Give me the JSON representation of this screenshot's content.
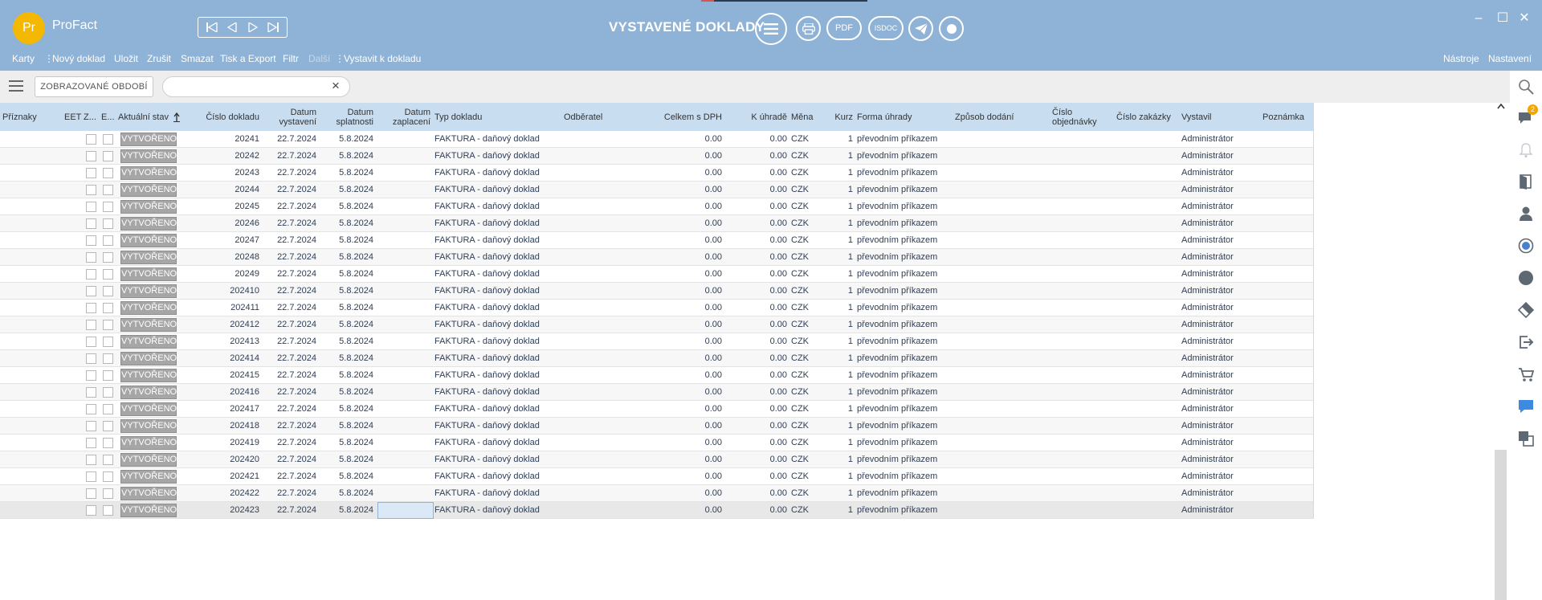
{
  "app": {
    "logo_text": "Pr",
    "name": "ProFact",
    "title": "VYSTAVENÉ DOKLADY",
    "pdf_label": "PDF",
    "isdoc_label": "ISDOC",
    "window_minimize": "–",
    "window_maximize": "☐",
    "window_close": "✕"
  },
  "menu": {
    "karty": "Karty",
    "novy": "Nový doklad",
    "ulozit": "Uložit",
    "zrusit": "Zrušit",
    "smazat": "Smazat",
    "tisk": "Tisk a Export",
    "filtr": "Filtr",
    "dalsi": "Další",
    "vystavit": "Vystavit k dokladu",
    "nastroje": "Nástroje",
    "nastaveni": "Nastavení",
    "separator": "⋮"
  },
  "toolbar": {
    "period_label": "ZOBRAZOVANÉ OBDOBÍ",
    "search_value": "",
    "search_clear": "×"
  },
  "notifications": {
    "messages_count": "2"
  },
  "columns": {
    "priznaky": "Příznaky",
    "eet": "EET",
    "z": "Z...",
    "e": "E...",
    "stav": "Aktuální stav",
    "cislo": "Číslo dokladu",
    "vystaveni": "Datum vystavení",
    "splatnosti": "Datum splatnosti",
    "zaplaceni": "Datum zaplacení",
    "typ": "Typ dokladu",
    "odberatel": "Odběratel",
    "celkem": "Celkem s DPH",
    "k_uhrade": "K úhradě",
    "mena": "Měna",
    "kurz": "Kurz",
    "forma": "Forma úhrady",
    "zpusob": "Způsob dodání",
    "objednavka": "Číslo objednávky",
    "zakazka": "Číslo zakázky",
    "vystavil": "Vystavil",
    "poznamka": "Poznámka"
  },
  "rows": [
    {
      "stav": "VYTVOŘENO",
      "cislo": "20241",
      "vystaveni": "22.7.2024",
      "splatnosti": "5.8.2024",
      "typ": "FAKTURA - daňový doklad",
      "celkem": "0.00",
      "k_uhrade": "0.00",
      "mena": "CZK",
      "kurz": "1",
      "forma": "převodním příkazem",
      "vystavil": "Administrátor"
    },
    {
      "stav": "VYTVOŘENO",
      "cislo": "20242",
      "vystaveni": "22.7.2024",
      "splatnosti": "5.8.2024",
      "typ": "FAKTURA - daňový doklad",
      "celkem": "0.00",
      "k_uhrade": "0.00",
      "mena": "CZK",
      "kurz": "1",
      "forma": "převodním příkazem",
      "vystavil": "Administrátor"
    },
    {
      "stav": "VYTVOŘENO",
      "cislo": "20243",
      "vystaveni": "22.7.2024",
      "splatnosti": "5.8.2024",
      "typ": "FAKTURA - daňový doklad",
      "celkem": "0.00",
      "k_uhrade": "0.00",
      "mena": "CZK",
      "kurz": "1",
      "forma": "převodním příkazem",
      "vystavil": "Administrátor"
    },
    {
      "stav": "VYTVOŘENO",
      "cislo": "20244",
      "vystaveni": "22.7.2024",
      "splatnosti": "5.8.2024",
      "typ": "FAKTURA - daňový doklad",
      "celkem": "0.00",
      "k_uhrade": "0.00",
      "mena": "CZK",
      "kurz": "1",
      "forma": "převodním příkazem",
      "vystavil": "Administrátor"
    },
    {
      "stav": "VYTVOŘENO",
      "cislo": "20245",
      "vystaveni": "22.7.2024",
      "splatnosti": "5.8.2024",
      "typ": "FAKTURA - daňový doklad",
      "celkem": "0.00",
      "k_uhrade": "0.00",
      "mena": "CZK",
      "kurz": "1",
      "forma": "převodním příkazem",
      "vystavil": "Administrátor"
    },
    {
      "stav": "VYTVOŘENO",
      "cislo": "20246",
      "vystaveni": "22.7.2024",
      "splatnosti": "5.8.2024",
      "typ": "FAKTURA - daňový doklad",
      "celkem": "0.00",
      "k_uhrade": "0.00",
      "mena": "CZK",
      "kurz": "1",
      "forma": "převodním příkazem",
      "vystavil": "Administrátor"
    },
    {
      "stav": "VYTVOŘENO",
      "cislo": "20247",
      "vystaveni": "22.7.2024",
      "splatnosti": "5.8.2024",
      "typ": "FAKTURA - daňový doklad",
      "celkem": "0.00",
      "k_uhrade": "0.00",
      "mena": "CZK",
      "kurz": "1",
      "forma": "převodním příkazem",
      "vystavil": "Administrátor"
    },
    {
      "stav": "VYTVOŘENO",
      "cislo": "20248",
      "vystaveni": "22.7.2024",
      "splatnosti": "5.8.2024",
      "typ": "FAKTURA - daňový doklad",
      "celkem": "0.00",
      "k_uhrade": "0.00",
      "mena": "CZK",
      "kurz": "1",
      "forma": "převodním příkazem",
      "vystavil": "Administrátor"
    },
    {
      "stav": "VYTVOŘENO",
      "cislo": "20249",
      "vystaveni": "22.7.2024",
      "splatnosti": "5.8.2024",
      "typ": "FAKTURA - daňový doklad",
      "celkem": "0.00",
      "k_uhrade": "0.00",
      "mena": "CZK",
      "kurz": "1",
      "forma": "převodním příkazem",
      "vystavil": "Administrátor"
    },
    {
      "stav": "VYTVOŘENO",
      "cislo": "202410",
      "vystaveni": "22.7.2024",
      "splatnosti": "5.8.2024",
      "typ": "FAKTURA - daňový doklad",
      "celkem": "0.00",
      "k_uhrade": "0.00",
      "mena": "CZK",
      "kurz": "1",
      "forma": "převodním příkazem",
      "vystavil": "Administrátor"
    },
    {
      "stav": "VYTVOŘENO",
      "cislo": "202411",
      "vystaveni": "22.7.2024",
      "splatnosti": "5.8.2024",
      "typ": "FAKTURA - daňový doklad",
      "celkem": "0.00",
      "k_uhrade": "0.00",
      "mena": "CZK",
      "kurz": "1",
      "forma": "převodním příkazem",
      "vystavil": "Administrátor"
    },
    {
      "stav": "VYTVOŘENO",
      "cislo": "202412",
      "vystaveni": "22.7.2024",
      "splatnosti": "5.8.2024",
      "typ": "FAKTURA - daňový doklad",
      "celkem": "0.00",
      "k_uhrade": "0.00",
      "mena": "CZK",
      "kurz": "1",
      "forma": "převodním příkazem",
      "vystavil": "Administrátor"
    },
    {
      "stav": "VYTVOŘENO",
      "cislo": "202413",
      "vystaveni": "22.7.2024",
      "splatnosti": "5.8.2024",
      "typ": "FAKTURA - daňový doklad",
      "celkem": "0.00",
      "k_uhrade": "0.00",
      "mena": "CZK",
      "kurz": "1",
      "forma": "převodním příkazem",
      "vystavil": "Administrátor"
    },
    {
      "stav": "VYTVOŘENO",
      "cislo": "202414",
      "vystaveni": "22.7.2024",
      "splatnosti": "5.8.2024",
      "typ": "FAKTURA - daňový doklad",
      "celkem": "0.00",
      "k_uhrade": "0.00",
      "mena": "CZK",
      "kurz": "1",
      "forma": "převodním příkazem",
      "vystavil": "Administrátor"
    },
    {
      "stav": "VYTVOŘENO",
      "cislo": "202415",
      "vystaveni": "22.7.2024",
      "splatnosti": "5.8.2024",
      "typ": "FAKTURA - daňový doklad",
      "celkem": "0.00",
      "k_uhrade": "0.00",
      "mena": "CZK",
      "kurz": "1",
      "forma": "převodním příkazem",
      "vystavil": "Administrátor"
    },
    {
      "stav": "VYTVOŘENO",
      "cislo": "202416",
      "vystaveni": "22.7.2024",
      "splatnosti": "5.8.2024",
      "typ": "FAKTURA - daňový doklad",
      "celkem": "0.00",
      "k_uhrade": "0.00",
      "mena": "CZK",
      "kurz": "1",
      "forma": "převodním příkazem",
      "vystavil": "Administrátor"
    },
    {
      "stav": "VYTVOŘENO",
      "cislo": "202417",
      "vystaveni": "22.7.2024",
      "splatnosti": "5.8.2024",
      "typ": "FAKTURA - daňový doklad",
      "celkem": "0.00",
      "k_uhrade": "0.00",
      "mena": "CZK",
      "kurz": "1",
      "forma": "převodním příkazem",
      "vystavil": "Administrátor"
    },
    {
      "stav": "VYTVOŘENO",
      "cislo": "202418",
      "vystaveni": "22.7.2024",
      "splatnosti": "5.8.2024",
      "typ": "FAKTURA - daňový doklad",
      "celkem": "0.00",
      "k_uhrade": "0.00",
      "mena": "CZK",
      "kurz": "1",
      "forma": "převodním příkazem",
      "vystavil": "Administrátor"
    },
    {
      "stav": "VYTVOŘENO",
      "cislo": "202419",
      "vystaveni": "22.7.2024",
      "splatnosti": "5.8.2024",
      "typ": "FAKTURA - daňový doklad",
      "celkem": "0.00",
      "k_uhrade": "0.00",
      "mena": "CZK",
      "kurz": "1",
      "forma": "převodním příkazem",
      "vystavil": "Administrátor"
    },
    {
      "stav": "VYTVOŘENO",
      "cislo": "202420",
      "vystaveni": "22.7.2024",
      "splatnosti": "5.8.2024",
      "typ": "FAKTURA - daňový doklad",
      "celkem": "0.00",
      "k_uhrade": "0.00",
      "mena": "CZK",
      "kurz": "1",
      "forma": "převodním příkazem",
      "vystavil": "Administrátor"
    },
    {
      "stav": "VYTVOŘENO",
      "cislo": "202421",
      "vystaveni": "22.7.2024",
      "splatnosti": "5.8.2024",
      "typ": "FAKTURA - daňový doklad",
      "celkem": "0.00",
      "k_uhrade": "0.00",
      "mena": "CZK",
      "kurz": "1",
      "forma": "převodním příkazem",
      "vystavil": "Administrátor"
    },
    {
      "stav": "VYTVOŘENO",
      "cislo": "202422",
      "vystaveni": "22.7.2024",
      "splatnosti": "5.8.2024",
      "typ": "FAKTURA - daňový doklad",
      "celkem": "0.00",
      "k_uhrade": "0.00",
      "mena": "CZK",
      "kurz": "1",
      "forma": "převodním příkazem",
      "vystavil": "Administrátor"
    },
    {
      "stav": "VYTVOŘENO",
      "cislo": "202423",
      "vystaveni": "22.7.2024",
      "splatnosti": "5.8.2024",
      "typ": "FAKTURA - daňový doklad",
      "celkem": "0.00",
      "k_uhrade": "0.00",
      "mena": "CZK",
      "kurz": "1",
      "forma": "převodním příkazem",
      "vystavil": "Administrátor",
      "selected": true
    }
  ]
}
